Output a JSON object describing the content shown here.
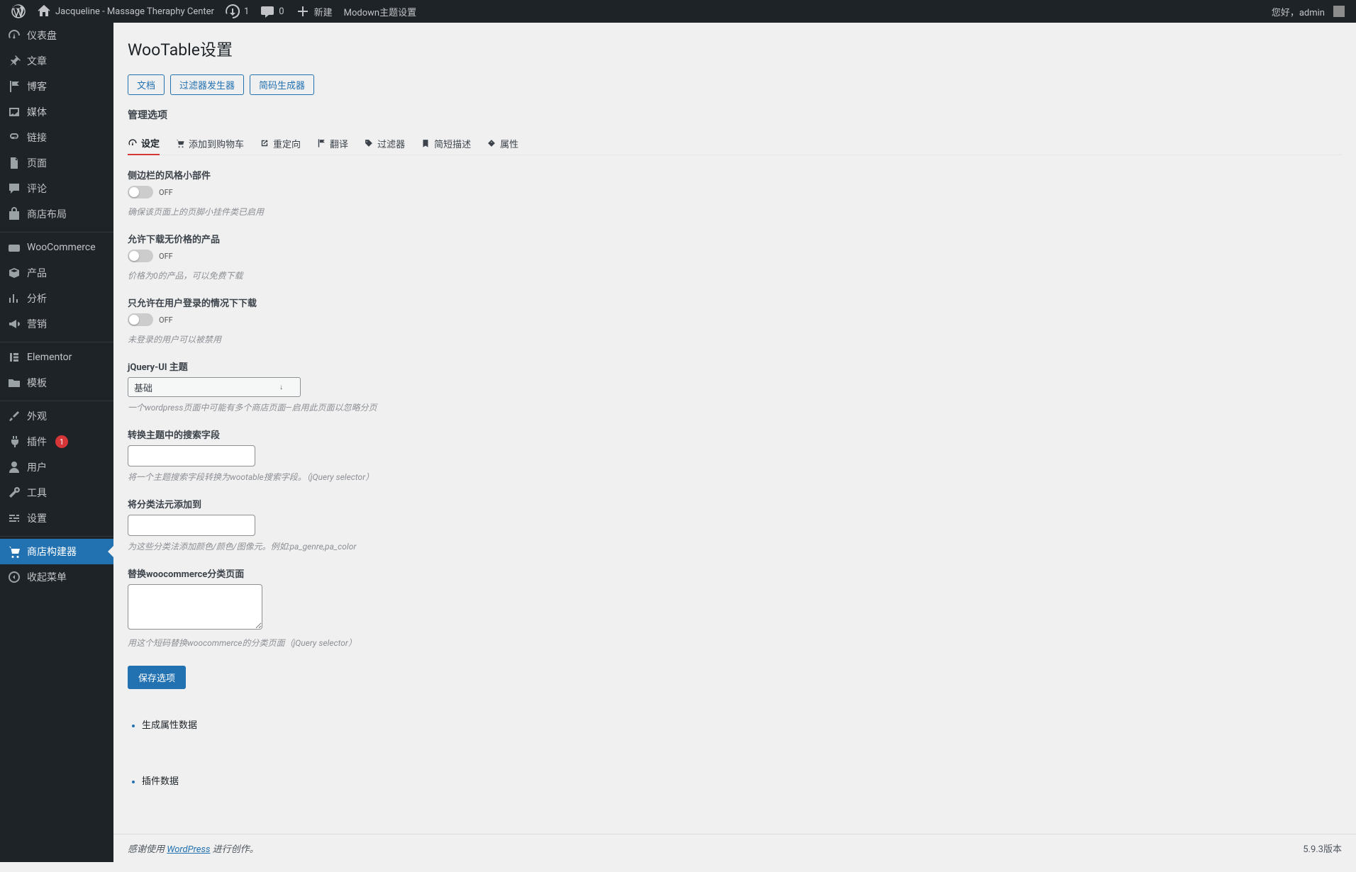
{
  "toolbar": {
    "site_name": "Jacqueline - Massage Theraphy Center",
    "updates_count": "1",
    "comments_count": "0",
    "new_label": "新建",
    "theme_settings_label": "Modown主题设置",
    "greeting": "您好，admin"
  },
  "sidebar": {
    "items": [
      {
        "id": "dashboard",
        "label": "仪表盘",
        "icon": "gauge"
      },
      {
        "id": "posts",
        "label": "文章",
        "icon": "pin"
      },
      {
        "id": "blog",
        "label": "博客",
        "icon": "flag"
      },
      {
        "id": "media",
        "label": "媒体",
        "icon": "media"
      },
      {
        "id": "links",
        "label": "链接",
        "icon": "link"
      },
      {
        "id": "pages",
        "label": "页面",
        "icon": "page"
      },
      {
        "id": "comments",
        "label": "评论",
        "icon": "chat"
      },
      {
        "id": "shop-layout",
        "label": "商店布局",
        "icon": "bag"
      },
      {
        "id": "woocommerce",
        "label": "WooCommerce",
        "icon": "woo"
      },
      {
        "id": "products",
        "label": "产品",
        "icon": "box"
      },
      {
        "id": "analytics",
        "label": "分析",
        "icon": "chart"
      },
      {
        "id": "marketing",
        "label": "营销",
        "icon": "megaphone"
      },
      {
        "id": "elementor",
        "label": "Elementor",
        "icon": "elementor"
      },
      {
        "id": "templates",
        "label": "模板",
        "icon": "folder"
      },
      {
        "id": "appearance",
        "label": "外观",
        "icon": "brush"
      },
      {
        "id": "plugins",
        "label": "插件",
        "icon": "plug",
        "badge": "1"
      },
      {
        "id": "users",
        "label": "用户",
        "icon": "user"
      },
      {
        "id": "tools",
        "label": "工具",
        "icon": "wrench"
      },
      {
        "id": "settings",
        "label": "设置",
        "icon": "sliders"
      },
      {
        "id": "shop-builder",
        "label": "商店构建器",
        "icon": "cart",
        "current": true
      },
      {
        "id": "collapse",
        "label": "收起菜单",
        "icon": "collapse"
      }
    ]
  },
  "page": {
    "title": "WooTable设置",
    "buttons": {
      "docs": "文档",
      "filter_gen": "过滤器发生器",
      "shortcode_gen": "简码生成器"
    },
    "section_title": "管理选项"
  },
  "tabs": [
    {
      "id": "settings",
      "label": "设定",
      "icon": "gauge",
      "active": true
    },
    {
      "id": "cart",
      "label": "添加到购物车",
      "icon": "cart"
    },
    {
      "id": "redirect",
      "label": "重定向",
      "icon": "external"
    },
    {
      "id": "translate",
      "label": "翻译",
      "icon": "flag"
    },
    {
      "id": "filter",
      "label": "过滤器",
      "icon": "tag"
    },
    {
      "id": "shortdesc",
      "label": "简短描述",
      "icon": "bookmark"
    },
    {
      "id": "attr",
      "label": "属性",
      "icon": "tag2"
    }
  ],
  "fields": {
    "sidebar_widget": {
      "label": "侧边栏的风格小部件",
      "state": "OFF",
      "desc": "确保该页面上的页脚小挂件类已启用"
    },
    "allow_no_price_dl": {
      "label": "允许下载无价格的产品",
      "state": "OFF",
      "desc": "价格为0的产品，可以免费下载"
    },
    "login_only_dl": {
      "label": "只允许在用户登录的情况下下载",
      "state": "OFF",
      "desc": "未登录的用户可以被禁用"
    },
    "jquery_theme": {
      "label": "jQuery-UI 主题",
      "value": "基础",
      "desc": "一个wordpress页面中可能有多个商店页面—启用此页面以忽略分页"
    },
    "search_field": {
      "label": "转换主题中的搜索字段",
      "value": "",
      "desc": "将一个主题搜索字段转换为wootable搜索字段。（jQuery selector）"
    },
    "tax_meta": {
      "label": "将分类法元添加到",
      "value": "",
      "desc": "为这些分类法添加颜色/颜色/图像元。例如:pa_genre,pa_color"
    },
    "replace_tax": {
      "label": "替换woocommerce分类页面",
      "value": "",
      "desc": "用这个短码替换woocommerce的分类页面（jQuery selector）"
    }
  },
  "save_label": "保存选项",
  "sublinks": {
    "attr_data": "生成属性数据",
    "plugin_data": "插件数据"
  },
  "footer": {
    "thanks_prefix": "感谢使用",
    "wp": "WordPress",
    "thanks_suffix": "进行创作。",
    "version": "5.9.3版本"
  }
}
